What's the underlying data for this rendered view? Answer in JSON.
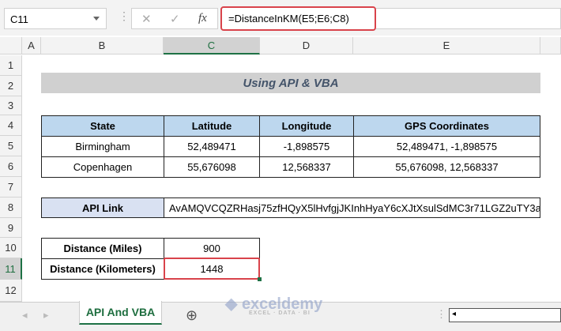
{
  "formula_bar": {
    "name_box": "C11",
    "formula": "=DistanceInKM(E5;E6;C8)",
    "cancel_icon": "✕",
    "enter_icon": "✓",
    "fx_label": "fx"
  },
  "columns": [
    "A",
    "B",
    "C",
    "D",
    "E"
  ],
  "rows": [
    "1",
    "2",
    "3",
    "4",
    "5",
    "6",
    "7",
    "8",
    "9",
    "10",
    "11",
    "12"
  ],
  "title": "Using API & VBA",
  "table": {
    "headers": [
      "State",
      "Latitude",
      "Longitude",
      "GPS Coordinates"
    ],
    "rows": [
      [
        "Birmingham",
        "52,489471",
        "-1,898575",
        "52,489471, -1,898575"
      ],
      [
        "Copenhagen",
        "55,676098",
        "12,568337",
        "55,676098, 12,568337"
      ]
    ]
  },
  "api": {
    "label": "API Link",
    "value": "AvAMQVCQZRHasj75zfHQyX5lHvfgjJKInhHyaY6cXJtXsulSdMC3r71LGZ2uTY3a"
  },
  "distance": {
    "miles_label": "Distance (Miles)",
    "miles_value": "900",
    "km_label": "Distance (Kilometers)",
    "km_value": "1448"
  },
  "sheet_tab": "API And VBA",
  "add_sheet": "⊕",
  "watermark": {
    "name": "exceldemy",
    "tagline": "EXCEL · DATA · BI"
  }
}
